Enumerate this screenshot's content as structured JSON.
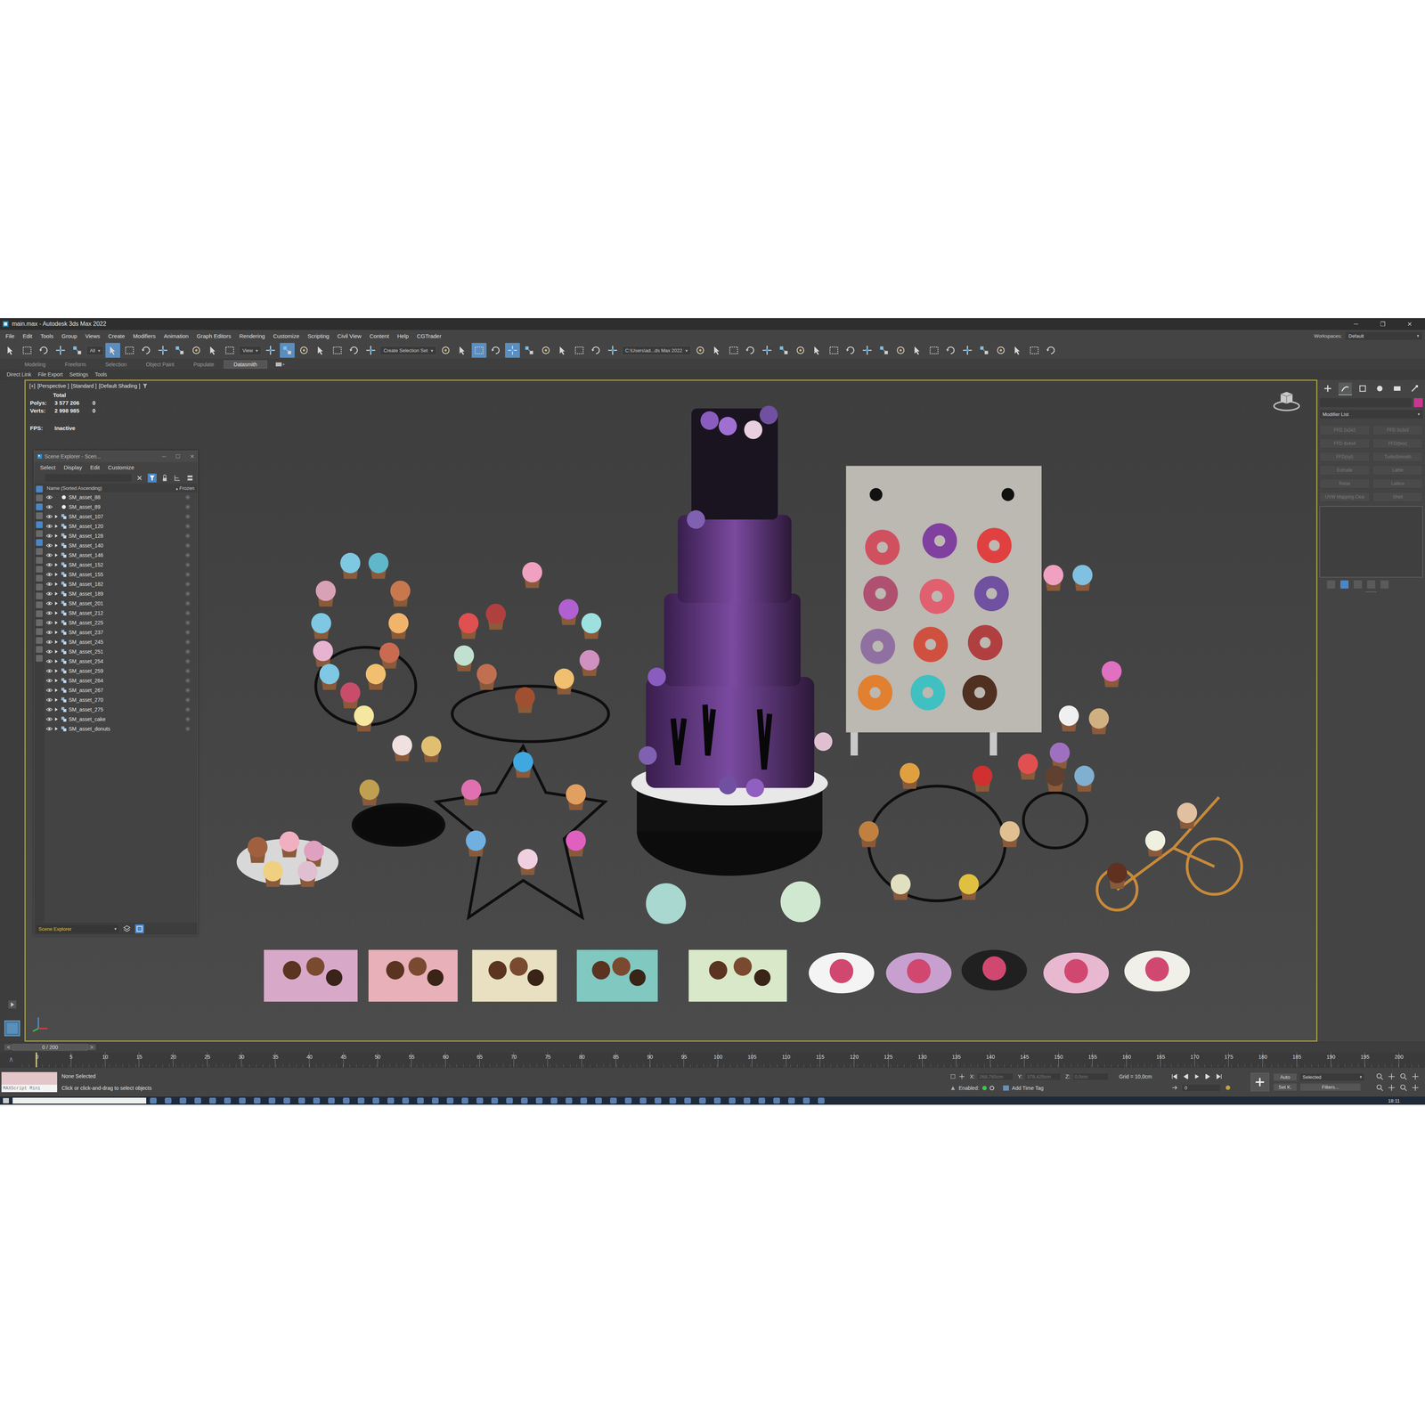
{
  "window": {
    "title": "main.max - Autodesk 3ds Max 2022",
    "controls": [
      "─",
      "❐",
      "✕"
    ]
  },
  "menu": {
    "items": [
      "File",
      "Edit",
      "Tools",
      "Group",
      "Views",
      "Create",
      "Modifiers",
      "Animation",
      "Graph Editors",
      "Rendering",
      "Customize",
      "Scripting",
      "Civil View",
      "Content",
      "Help",
      "CGTrader"
    ],
    "workspaces_label": "Workspaces:",
    "workspace": "Default"
  },
  "toolbar": {
    "items": [
      {
        "kind": "icon",
        "selected": false
      },
      {
        "kind": "icon",
        "selected": false
      },
      {
        "kind": "icon",
        "selected": false
      },
      {
        "kind": "icon",
        "selected": false
      },
      {
        "kind": "icon",
        "selected": false
      },
      {
        "kind": "dropdown",
        "label": "All"
      },
      {
        "kind": "icon",
        "selected": true
      },
      {
        "kind": "icon",
        "selected": false
      },
      {
        "kind": "icon",
        "selected": false
      },
      {
        "kind": "icon",
        "selected": false
      },
      {
        "kind": "icon",
        "selected": false
      },
      {
        "kind": "icon",
        "selected": false
      },
      {
        "kind": "icon",
        "selected": false
      },
      {
        "kind": "icon",
        "selected": false
      },
      {
        "kind": "dropdown",
        "label": "View"
      },
      {
        "kind": "icon",
        "selected": false
      },
      {
        "kind": "icon",
        "selected": true
      },
      {
        "kind": "icon",
        "selected": false
      },
      {
        "kind": "icon",
        "selected": false
      },
      {
        "kind": "icon",
        "selected": false
      },
      {
        "kind": "icon",
        "selected": false
      },
      {
        "kind": "icon",
        "selected": false
      },
      {
        "kind": "dropdown",
        "label": "Create Selection Set"
      },
      {
        "kind": "icon",
        "selected": false
      },
      {
        "kind": "icon",
        "selected": false
      },
      {
        "kind": "icon",
        "selected": true
      },
      {
        "kind": "icon",
        "selected": false
      },
      {
        "kind": "icon",
        "selected": true
      },
      {
        "kind": "icon",
        "selected": false
      },
      {
        "kind": "icon",
        "selected": false
      },
      {
        "kind": "icon",
        "selected": false
      },
      {
        "kind": "icon",
        "selected": false
      },
      {
        "kind": "icon",
        "selected": false
      },
      {
        "kind": "icon",
        "selected": false
      },
      {
        "kind": "dropdown",
        "label": "C:\\Users\\ad...ds Max 2022"
      },
      {
        "kind": "icon",
        "selected": false
      },
      {
        "kind": "icon",
        "selected": false
      },
      {
        "kind": "icon",
        "selected": false
      },
      {
        "kind": "icon",
        "selected": false
      },
      {
        "kind": "icon",
        "selected": false
      },
      {
        "kind": "icon",
        "selected": false
      },
      {
        "kind": "icon",
        "selected": false
      },
      {
        "kind": "icon",
        "selected": false
      },
      {
        "kind": "icon",
        "selected": false
      },
      {
        "kind": "icon",
        "selected": false
      },
      {
        "kind": "icon",
        "selected": false
      },
      {
        "kind": "icon",
        "selected": false
      },
      {
        "kind": "icon",
        "selected": false
      },
      {
        "kind": "icon",
        "selected": false
      },
      {
        "kind": "icon",
        "selected": false
      },
      {
        "kind": "icon",
        "selected": false
      },
      {
        "kind": "icon",
        "selected": false
      },
      {
        "kind": "icon",
        "selected": false
      },
      {
        "kind": "icon",
        "selected": false
      },
      {
        "kind": "icon",
        "selected": false
      },
      {
        "kind": "icon",
        "selected": false
      },
      {
        "kind": "icon",
        "selected": false
      }
    ]
  },
  "ribbon": {
    "tabs": [
      {
        "label": "Modeling",
        "selected": false
      },
      {
        "label": "Freeform",
        "selected": false
      },
      {
        "label": "Selection",
        "selected": false
      },
      {
        "label": "Object Paint",
        "selected": false
      },
      {
        "label": "Populate",
        "selected": false
      },
      {
        "label": "Datasmith",
        "selected": true
      }
    ]
  },
  "sub_toolbar": {
    "items": [
      "Direct Link",
      "File Export",
      "Settings",
      "Tools"
    ]
  },
  "viewport": {
    "labels": [
      "[+]",
      "[Perspective ]",
      "[Standard ]",
      "[Default Shading ]"
    ],
    "stats": {
      "title": "Total",
      "rows": [
        {
          "label": "Polys:",
          "value": "3 577 206",
          "selected_value": "0"
        },
        {
          "label": "Verts:",
          "value": "2 998 985",
          "selected_value": "0"
        }
      ],
      "fps_label": "FPS:",
      "fps_value": "Inactive"
    }
  },
  "scene_explorer": {
    "title": "Scene Explorer - Scen...",
    "controls": [
      "─",
      "☐",
      "✕"
    ],
    "menu": [
      "Select",
      "Display",
      "Edit",
      "Customize"
    ],
    "column": "Name (Sorted Ascending)",
    "sort_mark": "▴",
    "frozen_column": "Frozen",
    "rows": [
      {
        "name": "SM_asset_88",
        "expandable": false
      },
      {
        "name": "SM_asset_89",
        "expandable": false
      },
      {
        "name": "SM_asset_107",
        "expandable": true
      },
      {
        "name": "SM_asset_120",
        "expandable": true
      },
      {
        "name": "SM_asset_128",
        "expandable": true
      },
      {
        "name": "SM_asset_140",
        "expandable": true
      },
      {
        "name": "SM_asset_146",
        "expandable": true
      },
      {
        "name": "SM_asset_152",
        "expandable": true
      },
      {
        "name": "SM_asset_155",
        "expandable": true
      },
      {
        "name": "SM_asset_182",
        "expandable": true
      },
      {
        "name": "SM_asset_189",
        "expandable": true
      },
      {
        "name": "SM_asset_201",
        "expandable": true
      },
      {
        "name": "SM_asset_212",
        "expandable": true
      },
      {
        "name": "SM_asset_225",
        "expandable": true
      },
      {
        "name": "SM_asset_237",
        "expandable": true
      },
      {
        "name": "SM_asset_245",
        "expandable": true
      },
      {
        "name": "SM_asset_251",
        "expandable": true
      },
      {
        "name": "SM_asset_254",
        "expandable": true
      },
      {
        "name": "SM_asset_259",
        "expandable": true
      },
      {
        "name": "SM_asset_264",
        "expandable": true
      },
      {
        "name": "SM_asset_267",
        "expandable": true
      },
      {
        "name": "SM_asset_270",
        "expandable": true
      },
      {
        "name": "SM_asset_275",
        "expandable": true
      },
      {
        "name": "SM_asset_cake",
        "expandable": true
      },
      {
        "name": "SM_asset_donuts",
        "expandable": true
      }
    ],
    "footer": "Scene Explorer"
  },
  "command_panel": {
    "tabs": [
      {
        "selected": false
      },
      {
        "selected": true
      },
      {
        "selected": false
      },
      {
        "selected": false
      },
      {
        "selected": false
      },
      {
        "selected": false
      }
    ],
    "swatch_color": "#c8378f",
    "modifier_list": "Modifier List",
    "modifiers": [
      "FFD 2x2x2",
      "FFD 3x3x3",
      "FFD 4x4x4",
      "FFD(box)",
      "FFD(cyl)",
      "TurboSmooth",
      "Extrude",
      "Lathe",
      "Relax",
      "Lattice",
      "UVW Mapping Clea",
      "Shell"
    ]
  },
  "timeline": {
    "slider": "0 / 200",
    "prev": "<",
    "next": ">",
    "ticks": [
      "0",
      "5",
      "10",
      "15",
      "20",
      "25",
      "30",
      "35",
      "40",
      "45",
      "50",
      "55",
      "60",
      "65",
      "70",
      "75",
      "80",
      "85",
      "90",
      "95",
      "100",
      "105",
      "110",
      "115",
      "120",
      "125",
      "130",
      "135",
      "140",
      "145",
      "150",
      "155",
      "160",
      "165",
      "170",
      "175",
      "180",
      "185",
      "190",
      "195",
      "200"
    ]
  },
  "status_bar": {
    "maxscript": "MAXScript Mini",
    "selection": "None Selected",
    "prompt": "Click or click-and-drag to select objects",
    "coords": [
      {
        "axis": "X:",
        "value": "268,765cm"
      },
      {
        "axis": "Y:",
        "value": "378,425cm"
      },
      {
        "axis": "Z:",
        "value": "0,0cm"
      }
    ],
    "grid": "Grid = 10,0cm",
    "enabled": "Enabled:",
    "time_tag": "Add Time Tag",
    "auto_key": "Auto",
    "key_filter": "Selected",
    "set_key": "Set K.",
    "filters": "Filters...",
    "frame": "0"
  },
  "taskbar": {
    "clock": "18:11"
  }
}
